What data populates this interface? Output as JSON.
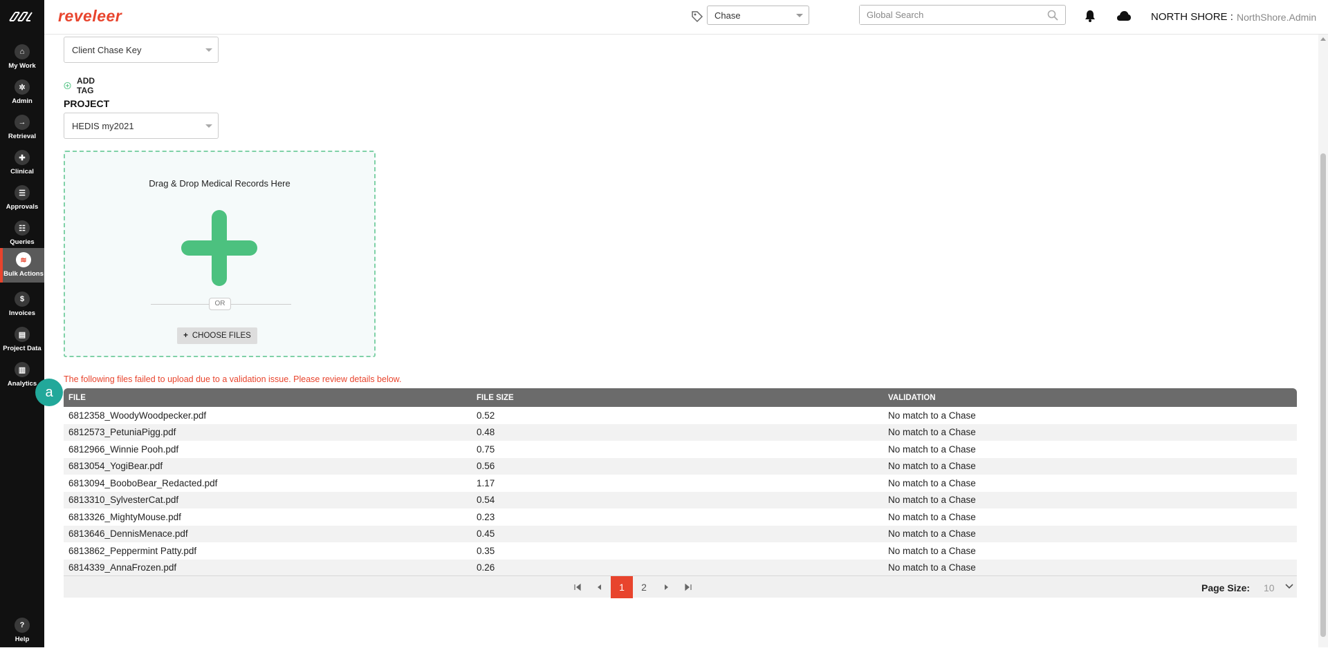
{
  "header": {
    "brand": "reveleer",
    "entity_select": "Chase",
    "search_placeholder": "Global Search",
    "org": "NORTH SHORE :",
    "user": "NorthShore.Admin"
  },
  "sidebar": {
    "items": [
      {
        "label": "My Work",
        "icon": "home-icon",
        "glyph": "⌂"
      },
      {
        "label": "Admin",
        "icon": "gear-icon",
        "glyph": "✲"
      },
      {
        "label": "Retrieval",
        "icon": "arrow-in-icon",
        "glyph": "→"
      },
      {
        "label": "Clinical",
        "icon": "clipboard-icon",
        "glyph": "✚"
      },
      {
        "label": "Approvals",
        "icon": "list-icon",
        "glyph": "☰"
      },
      {
        "label": "Queries",
        "icon": "doc-icon",
        "glyph": "☷"
      },
      {
        "label": "Bulk Actions",
        "icon": "layers-icon",
        "glyph": "≋"
      },
      {
        "label": "Invoices",
        "icon": "dollar-icon",
        "glyph": "$"
      },
      {
        "label": "Project Data",
        "icon": "folder-icon",
        "glyph": "▤"
      },
      {
        "label": "Analytics",
        "icon": "chart-icon",
        "glyph": "▥"
      }
    ],
    "help": "Help"
  },
  "main": {
    "tag_select": "Client Chase Key",
    "add_tag": "ADD TAG",
    "project_label": "PROJECT",
    "project_select": "HEDIS my2021",
    "dropzone_title": "Drag & Drop Medical Records Here",
    "or": "OR",
    "choose_files": "CHOOSE FILES",
    "error": "The following files failed to upload due to a validation issue. Please review details below."
  },
  "table": {
    "columns": [
      "FILE",
      "FILE SIZE",
      "VALIDATION"
    ],
    "rows": [
      [
        "6812358_WoodyWoodpecker.pdf",
        "0.52",
        "No match to a Chase"
      ],
      [
        "6812573_PetuniaPigg.pdf",
        "0.48",
        "No match to a Chase"
      ],
      [
        "6812966_Winnie Pooh.pdf",
        "0.75",
        "No match to a Chase"
      ],
      [
        "6813054_YogiBear.pdf",
        "0.56",
        "No match to a Chase"
      ],
      [
        "6813094_BooboBear_Redacted.pdf",
        "1.17",
        "No match to a Chase"
      ],
      [
        "6813310_SylvesterCat.pdf",
        "0.54",
        "No match to a Chase"
      ],
      [
        "6813326_MightyMouse.pdf",
        "0.23",
        "No match to a Chase"
      ],
      [
        "6813646_DennisMenace.pdf",
        "0.45",
        "No match to a Chase"
      ],
      [
        "6813862_Peppermint Patty.pdf",
        "0.35",
        "No match to a Chase"
      ],
      [
        "6814339_AnnaFrozen.pdf",
        "0.26",
        "No match to a Chase"
      ]
    ]
  },
  "pager": {
    "pages": [
      "1",
      "2"
    ],
    "current": "1",
    "page_size_label": "Page Size:",
    "page_size": "10"
  },
  "annotation": "a",
  "colors": {
    "accent": "#e8442d",
    "sidebar": "#111111",
    "plus": "#4cc17f",
    "table_header": "#6b6b6b",
    "badge": "#22a89a"
  }
}
